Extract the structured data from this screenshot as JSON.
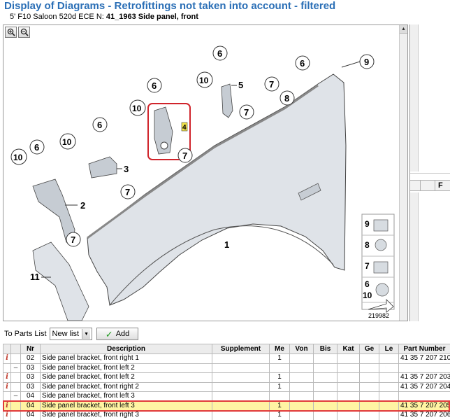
{
  "header": {
    "title": "Display of Diagrams - Retrofittings not taken into account - filtered",
    "vehicle": "5' F10 Saloon 520d ECE",
    "group_prefix": "N:",
    "group": "41_1963 Side panel, front"
  },
  "diagram": {
    "callouts": {
      "c1": "1",
      "c2": "2",
      "c3": "3",
      "c4": "4",
      "c5": "5",
      "c6": "6",
      "c7": "7",
      "c8": "8",
      "c9": "9",
      "c10": "10",
      "c11": "11"
    },
    "legend_numbers": {
      "l9": "9",
      "l8": "8",
      "l7": "7",
      "l6": "6",
      "l10": "10"
    },
    "image_number": "219982"
  },
  "parts_toolbar": {
    "label": "To Parts List",
    "list_value": "New list",
    "add_label": "Add"
  },
  "table": {
    "columns": [
      "",
      "",
      "Nr",
      "Description",
      "Supplement",
      "Me",
      "Von",
      "Bis",
      "Kat",
      "Ge",
      "Le",
      "Part Number"
    ],
    "rows": [
      {
        "info": "i",
        "dash": "",
        "nr": "02",
        "desc": "Side panel bracket, front right 1",
        "me": "1",
        "part": "41 35 7 207 210"
      },
      {
        "info": "",
        "dash": "–",
        "nr": "03",
        "desc": "Side panel bracket, front left 2",
        "me": "",
        "part": ""
      },
      {
        "info": "i",
        "dash": "",
        "nr": "03",
        "desc": "Side panel bracket, front left 2",
        "me": "1",
        "part": "41 35 7 207 203"
      },
      {
        "info": "i",
        "dash": "",
        "nr": "03",
        "desc": "Side panel bracket, front right 2",
        "me": "1",
        "part": "41 35 7 207 204"
      },
      {
        "info": "",
        "dash": "–",
        "nr": "04",
        "desc": "Side panel bracket, front left 3",
        "me": "",
        "part": ""
      },
      {
        "info": "i",
        "dash": "",
        "nr": "04",
        "desc": "Side panel bracket, front left 3",
        "me": "1",
        "part": "41 35 7 207 205"
      },
      {
        "info": "i",
        "dash": "",
        "nr": "04",
        "desc": "Side panel bracket, front right 3",
        "me": "1",
        "part": "41 35 7 207 206"
      }
    ]
  }
}
